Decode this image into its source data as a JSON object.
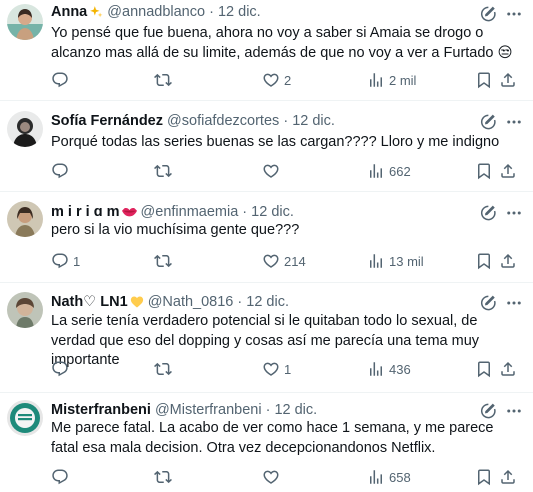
{
  "colors": {
    "text": "#0f1419",
    "secondary": "#536471",
    "divider": "#eff3f4",
    "heart_emoji": "#e0245e",
    "sparkle": "#f4b400"
  },
  "tweets": [
    {
      "name": "Anna",
      "name_emoji": "sparkles-emoji",
      "handle": "@annadblanco",
      "sep": "·",
      "date": "12 dic.",
      "text": "Yo pensé que fue buena, ahora no voy a saber si Amaia se drogo o alcanzo mas allá de su limite, además de que no voy a ver a Furtado 😒",
      "reply_count": "",
      "retweet_count": "",
      "like_count": "2",
      "views": "2 mil"
    },
    {
      "name": "Sofía Fernández",
      "handle": "@sofiafdezcortes",
      "sep": "·",
      "date": "12 dic.",
      "text": "Porqué todas las series buenas se las cargan???? Lloro y me indigno",
      "reply_count": "",
      "retweet_count": "",
      "like_count": "",
      "views": "662"
    },
    {
      "name": "m i r i ɑ m",
      "name_emoji": "lips-emoji",
      "handle": "@enfinmaemia",
      "sep": "·",
      "date": "12 dic.",
      "text": "pero si la vio muchísima gente que???",
      "reply_count": "1",
      "retweet_count": "",
      "like_count": "214",
      "views": "13 mil"
    },
    {
      "name": "Nath♡ LN1",
      "name_emoji": "yellow-heart-emoji",
      "handle": "@Nath_0816",
      "sep": "·",
      "date": "12 dic.",
      "text": "La serie tenía verdadero potencial si le quitaban todo lo sexual, de verdad que eso del dopping y cosas así me parecía una tema muy importante",
      "reply_count": "",
      "retweet_count": "",
      "like_count": "1",
      "views": "436"
    },
    {
      "name": "Misterfranbeni",
      "handle": "@Misterfranbeni",
      "sep": "·",
      "date": "12 dic.",
      "text": "Me parece fatal. La acabo de ver como hace 1 semana, y me parece fatal esa mala decision. Otra vez decepcionandonos Netflix.",
      "reply_count": "",
      "retweet_count": "",
      "like_count": "",
      "views": "658"
    }
  ]
}
